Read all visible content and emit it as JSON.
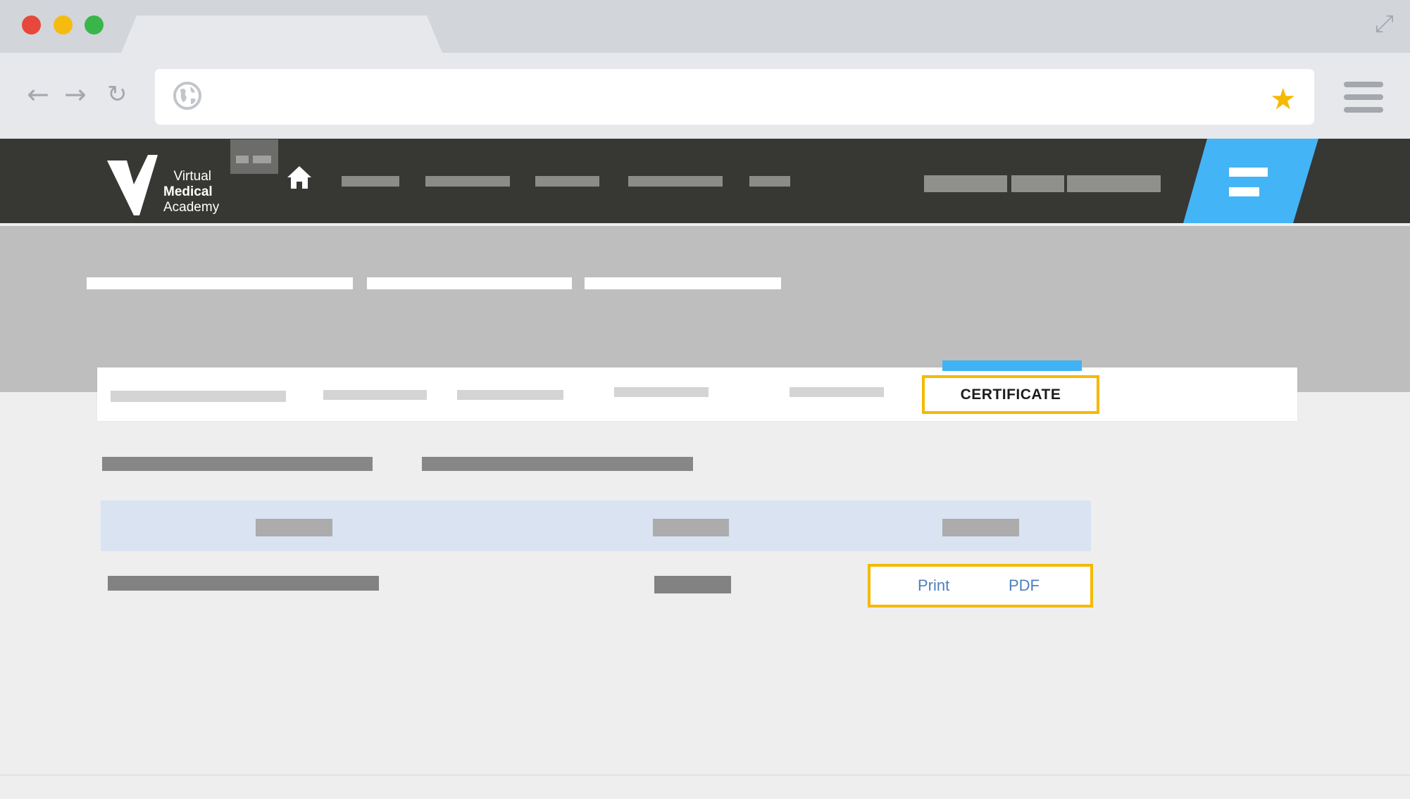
{
  "browser": {
    "window_controls": [
      {
        "name": "close",
        "color": "#e8473c"
      },
      {
        "name": "minimize",
        "color": "#f5bc0f"
      },
      {
        "name": "maximize",
        "color": "#38b64a"
      }
    ],
    "icons": {
      "back": "←",
      "forward": "→",
      "reload": "↻",
      "fullscreen": "⤢",
      "globe": "globe-icon",
      "star": "★",
      "menu": "hamburger-icon"
    },
    "star_color": "#f5b900"
  },
  "site": {
    "logo": {
      "line1": "Virtual",
      "line2": "Medical",
      "line3": "Academy"
    },
    "home_icon": "home-icon",
    "accent_color": "#43b4f6"
  },
  "tabs": {
    "active_label": "CERTIFICATE"
  },
  "table": {
    "actions": {
      "print_label": "Print",
      "pdf_label": "PDF"
    }
  },
  "highlight_color": "#f5b900"
}
